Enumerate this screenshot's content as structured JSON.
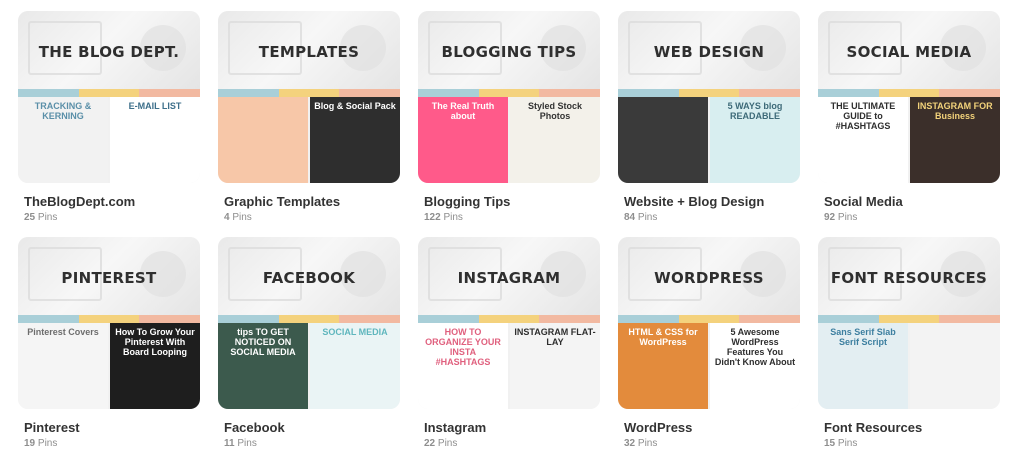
{
  "boards": [
    {
      "title": "THE BLOG DEPT.",
      "name": "TheBlogDept.com",
      "pins": "25",
      "pins_label": "Pins",
      "left": {
        "text": "TRACKING & KERNING",
        "bg": "#f2f2f2",
        "color": "#5a8fa8"
      },
      "right": {
        "text": "E-MAIL LIST",
        "bg": "#ffffff",
        "color": "#3d6f8a"
      }
    },
    {
      "title": "TEMPLATES",
      "name": "Graphic Templates",
      "pins": "4",
      "pins_label": "Pins",
      "left": {
        "text": "",
        "bg": "#f7c7a8",
        "color": "#555"
      },
      "right": {
        "text": "Blog & Social Pack",
        "bg": "#2e2e2e",
        "color": "#ffffff"
      }
    },
    {
      "title": "BLOGGING TIPS",
      "name": "Blogging Tips",
      "pins": "122",
      "pins_label": "Pins",
      "left": {
        "text": "The Real Truth about",
        "bg": "#ff5a8a",
        "color": "#ffffff"
      },
      "right": {
        "text": "Styled Stock Photos",
        "bg": "#f3f1ea",
        "color": "#333333"
      }
    },
    {
      "title": "WEB DESIGN",
      "name": "Website + Blog Design",
      "pins": "84",
      "pins_label": "Pins",
      "left": {
        "text": "",
        "bg": "#3a3a3a",
        "color": "#fff"
      },
      "right": {
        "text": "5 WAYS blog READABLE",
        "bg": "#d8eef0",
        "color": "#3d6a78"
      }
    },
    {
      "title": "SOCIAL MEDIA",
      "name": "Social Media",
      "pins": "92",
      "pins_label": "Pins",
      "left": {
        "text": "THE ULTIMATE GUIDE to #HASHTAGS",
        "bg": "#ffffff",
        "color": "#2e2e2e"
      },
      "right": {
        "text": "INSTAGRAM FOR Business",
        "bg": "#3b2f2a",
        "color": "#f2d27a"
      }
    },
    {
      "title": "PINTEREST",
      "name": "Pinterest",
      "pins": "19",
      "pins_label": "Pins",
      "left": {
        "text": "Pinterest Covers",
        "bg": "#f5f5f5",
        "color": "#6d6d6d"
      },
      "right": {
        "text": "How To Grow Your Pinterest With Board Looping",
        "bg": "#1e1e1e",
        "color": "#ffffff"
      }
    },
    {
      "title": "FACEBOOK",
      "name": "Facebook",
      "pins": "11",
      "pins_label": "Pins",
      "left": {
        "text": "tips TO GET NOTICED ON SOCIAL MEDIA",
        "bg": "#3c5a4d",
        "color": "#ffffff"
      },
      "right": {
        "text": "SOCIAL MEDIA",
        "bg": "#eaf4f5",
        "color": "#5fb6bd"
      }
    },
    {
      "title": "INSTAGRAM",
      "name": "Instagram",
      "pins": "22",
      "pins_label": "Pins",
      "left": {
        "text": "HOW TO ORGANIZE YOUR INSTA #HASHTAGS",
        "bg": "#ffffff",
        "color": "#e0607e"
      },
      "right": {
        "text": "INSTAGRAM FLAT-LAY",
        "bg": "#f4f4f4",
        "color": "#2e2e2e"
      }
    },
    {
      "title": "WORDPRESS",
      "name": "WordPress",
      "pins": "32",
      "pins_label": "Pins",
      "left": {
        "text": "HTML & CSS for WordPress",
        "bg": "#e38b3c",
        "color": "#ffffff"
      },
      "right": {
        "text": "5 Awesome WordPress Features You Didn't Know About",
        "bg": "#ffffff",
        "color": "#2e2e2e"
      }
    },
    {
      "title": "FONT RESOURCES",
      "name": "Font Resources",
      "pins": "15",
      "pins_label": "Pins",
      "left": {
        "text": "Sans Serif Slab Serif Script",
        "bg": "#e3eef2",
        "color": "#3d7fa0"
      },
      "right": {
        "text": "",
        "bg": "#f3f3f3",
        "color": "#e07a5f"
      }
    }
  ]
}
